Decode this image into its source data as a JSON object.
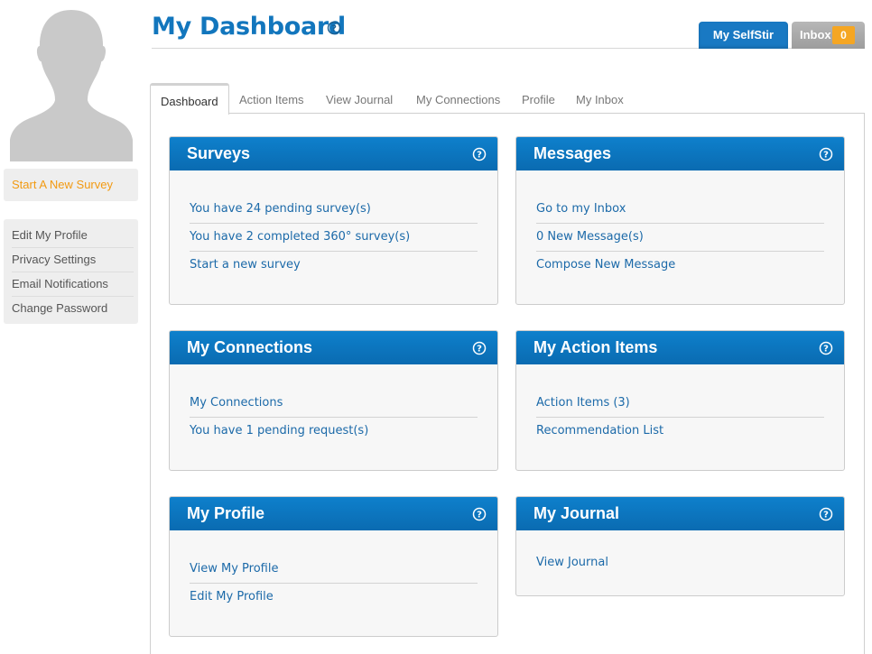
{
  "sidebar": {
    "start_survey": "Start A New Survey",
    "account_items": [
      "Edit My Profile",
      "Privacy Settings",
      "Email Notifications",
      "Change Password"
    ]
  },
  "header": {
    "title": "My Dashboard",
    "selfstir_button": "My SelfStir",
    "inbox_button": "Inbox",
    "inbox_count": "0"
  },
  "tabs": [
    "Dashboard",
    "Action Items",
    "View Journal",
    "My Connections",
    "Profile",
    "My Inbox"
  ],
  "panels": {
    "surveys": {
      "title": "Surveys",
      "links": [
        "You have 24 pending survey(s)",
        "You have 2 completed 360° survey(s)",
        "Start a new survey"
      ]
    },
    "messages": {
      "title": "Messages",
      "links": [
        "Go to my Inbox",
        "0 New Message(s)",
        "Compose New Message"
      ]
    },
    "connections": {
      "title": "My Connections",
      "links": [
        "My Connections",
        "You have 1 pending request(s)"
      ]
    },
    "action_items": {
      "title": "My Action Items",
      "links": [
        "Action Items (3)",
        "Recommendation List"
      ]
    },
    "profile": {
      "title": "My Profile",
      "links": [
        "View My Profile",
        "Edit My Profile"
      ]
    },
    "journal": {
      "title": "My Journal",
      "links": [
        "View Journal"
      ]
    }
  },
  "colors": {
    "brand_blue": "#1276bd",
    "panel_header_blue": "#0a6bb1",
    "link_blue": "#1c6aa9",
    "accent_orange": "#f29a12",
    "badge_orange": "#f5a623"
  },
  "icons": {
    "help": "question-circle-icon",
    "avatar": "default-user-silhouette"
  }
}
